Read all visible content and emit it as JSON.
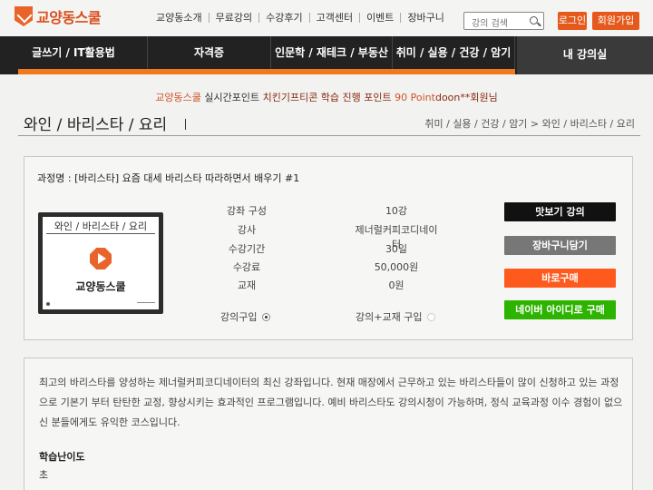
{
  "brand": {
    "name": "교양동스쿨"
  },
  "top_nav": [
    "교양동소개",
    "무료강의",
    "수강후기",
    "고객센터",
    "이벤트",
    "장바구니"
  ],
  "search": {
    "placeholder": "강의 검색"
  },
  "auth": {
    "login": "로그인",
    "signup": "회원가입"
  },
  "main_nav": [
    "글쓰기 / IT활용법",
    "자격증",
    "인문학 / 재테크 / 부동산",
    "취미 / 실용 / 건강 / 암기"
  ],
  "my_course": "내 강의실",
  "welcome": {
    "brand": "교양동스쿨",
    "points_text": "실시간포인트",
    "event": "치킨기프티콘 학습 진행 포인트",
    "points_value": "90 Point",
    "user": "doon**회원님"
  },
  "page_title": "와인 / 바리스타 / 요리",
  "breadcrumb": "취미 / 실용 / 건강 / 암기 > 와인 / 바리스타 / 요리",
  "course": {
    "name_label": "과정명 :",
    "name": "[바리스타] 요즘 대세 바리스타 따라하면서 배우기 #1",
    "thumbnail": {
      "category": "와인 / 바리스타 / 요리",
      "brand": "교양동스쿨"
    },
    "info": [
      {
        "key": "강좌 구성",
        "value": "10강"
      },
      {
        "key": "강사",
        "value": "제너럴커피코디네이터"
      },
      {
        "key": "수강기간",
        "value": "30일"
      },
      {
        "key": "수강료",
        "value": "50,000원"
      },
      {
        "key": "교재",
        "value": "0원"
      }
    ],
    "options": [
      {
        "label": "강의구입",
        "selected": true
      },
      {
        "label": "강의+교재 구입",
        "selected": false
      }
    ],
    "buttons": {
      "preview": "맛보기 강의",
      "cart": "장바구니담기",
      "buy": "바로구매",
      "naver": "네이버 아이디로 구매"
    }
  },
  "description": "최고의 바리스타를 양성하는 제너럴커피코디네이터의 최신 강좌입니다. 현재 매장에서 근무하고 있는 바리스타들이 많이 신청하고 있는 과정으로 기본기 부터 탄탄한 교정, 향상시키는 효과적인 프로그램입니다. 예비 바리스타도 강의시청이 가능하며, 정식 교육과정 이수 경험이 없으신 분들에게도 유익한 코스입니다.",
  "level": {
    "label": "학습난이도",
    "value": "초"
  },
  "colors": {
    "accent": "#e55a1c",
    "nav_bg": "#222222",
    "orange_bar": "#f07a1a",
    "buy": "#ff5a1e",
    "naver": "#2db400",
    "cart": "#777777",
    "preview": "#111111"
  }
}
